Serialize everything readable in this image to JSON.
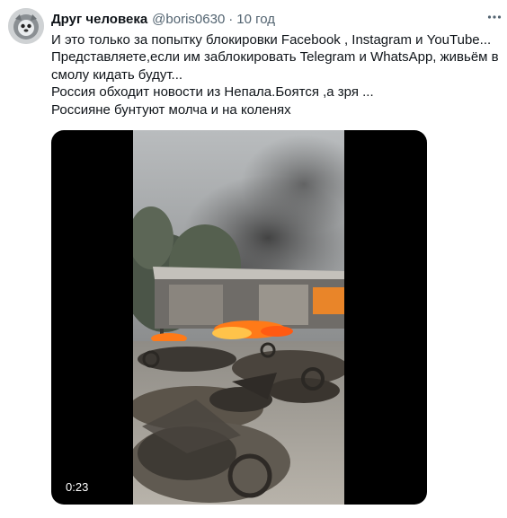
{
  "tweet": {
    "author": {
      "display_name": "Друг человека",
      "handle": "@boris0630",
      "avatar_icon": "avatar-icon"
    },
    "separator": "·",
    "time": "10 год",
    "more_icon": "more-icon",
    "text_lines": [
      "И это только за попытку блокировки Facebook , Instagram и YouTube...",
      "Представляете,если им заблокировать Telegram и WhatsApp, живьём в",
      "смолу кидать будут...",
      "Россия обходит новости из Непала.Боятся ,а зря ...",
      "Россияне бунтуют молча и на коленях"
    ],
    "media": {
      "type": "video",
      "duration": "0:23"
    }
  }
}
